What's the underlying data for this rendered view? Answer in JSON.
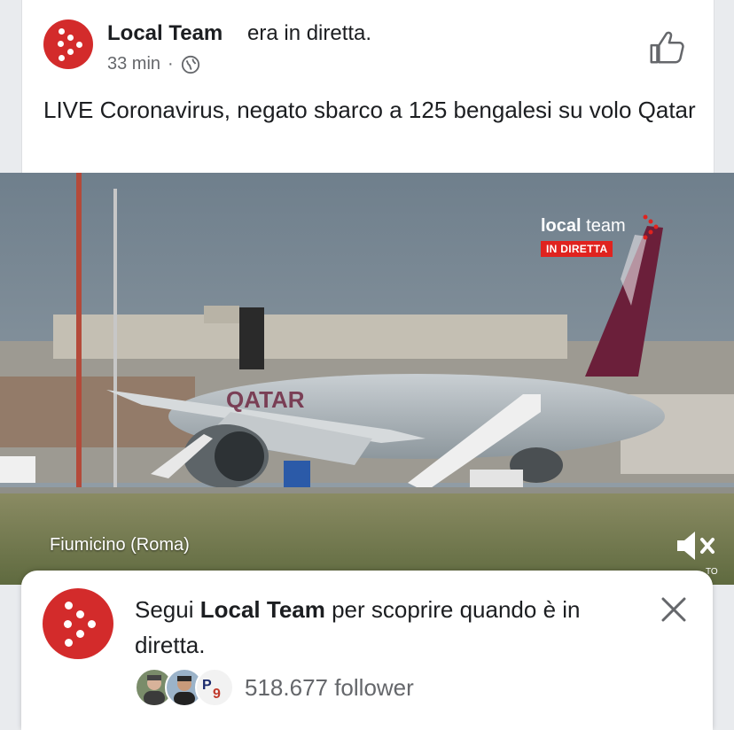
{
  "post": {
    "page_name": "Local Team",
    "action": "era in diretta.",
    "time": "33 min",
    "separator": "·",
    "visibility_icon": "globe-icon",
    "like_icon": "thumbs-up-icon",
    "text": "LIVE Coronavirus, negato sbarco a 125 bengalesi su volo Qatar"
  },
  "video": {
    "brand_name_bold": "local",
    "brand_name_rest": " team",
    "live_badge": "IN DIRETTA",
    "location": "Fiumicino (Roma)",
    "mute_icon": "speaker-muted-icon",
    "watermark": "TO"
  },
  "follow": {
    "prefix": "Segui ",
    "page_name": "Local Team",
    "suffix": " per scoprire quando è in diretta.",
    "close_icon": "close-icon",
    "follower_count": "518.677 follower"
  },
  "colors": {
    "brand_red": "#d32b2b",
    "live_red": "#e0231f",
    "secondary_text": "#65676b"
  }
}
